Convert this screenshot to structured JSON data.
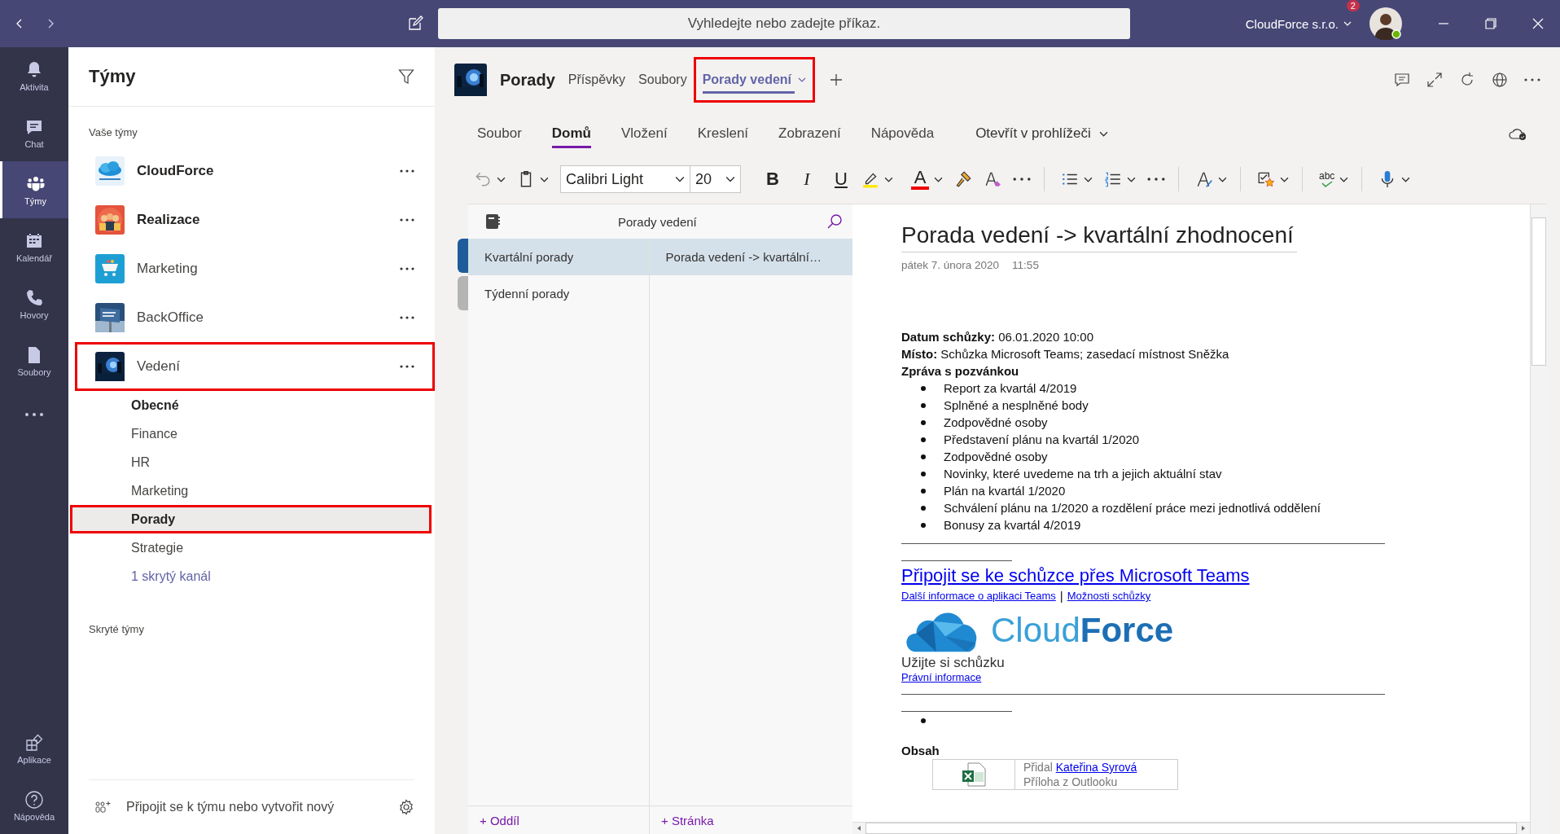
{
  "top_bar": {
    "search": {
      "placeholder": "Vyhledejte nebo zadejte příkaz."
    },
    "organization": "CloudForce s.r.o.",
    "notification_count": "2"
  },
  "rail": {
    "items": [
      {
        "label": "Aktivita",
        "selected": false
      },
      {
        "label": "Chat",
        "selected": false
      },
      {
        "label": "Týmy",
        "selected": true
      },
      {
        "label": "Kalendář",
        "selected": false
      },
      {
        "label": "Hovory",
        "selected": false
      },
      {
        "label": "Soubory",
        "selected": false
      }
    ],
    "bottom_items": [
      {
        "label": "Aplikace"
      },
      {
        "label": "Nápověda"
      }
    ]
  },
  "sidebar": {
    "title": "Týmy",
    "section_label": "Vaše týmy",
    "teams": [
      {
        "name": "CloudForce",
        "unread": true,
        "highlighted": false
      },
      {
        "name": "Realizace",
        "unread": true,
        "highlighted": false
      },
      {
        "name": "Marketing",
        "unread": false,
        "highlighted": false
      },
      {
        "name": "BackOffice",
        "unread": false,
        "highlighted": false
      },
      {
        "name": "Vedení",
        "unread": false,
        "highlighted": true,
        "children": [
          {
            "name": "Obecné",
            "unread": true,
            "selected": false,
            "highlighted": false
          },
          {
            "name": "Finance",
            "unread": false,
            "selected": false,
            "highlighted": false
          },
          {
            "name": "HR",
            "unread": false,
            "selected": false,
            "highlighted": false
          },
          {
            "name": "Marketing",
            "unread": false,
            "selected": false,
            "highlighted": false
          },
          {
            "name": "Porady",
            "unread": false,
            "selected": true,
            "highlighted": true
          },
          {
            "name": "Strategie",
            "unread": false,
            "selected": false,
            "highlighted": false
          }
        ],
        "hidden_channels_link": "1 skrytý kanál"
      }
    ],
    "hidden_teams_label": "Skryté týmy",
    "join_label": "Připojit se k týmu nebo vytvořit nový"
  },
  "channel_header": {
    "title": "Porady",
    "tabs": [
      {
        "label": "Příspěvky",
        "selected": false,
        "highlighted": false,
        "dropdown": false
      },
      {
        "label": "Soubory",
        "selected": false,
        "highlighted": false,
        "dropdown": false
      },
      {
        "label": "Porady vedení",
        "selected": true,
        "highlighted": true,
        "dropdown": true
      }
    ]
  },
  "ribbon": {
    "tabs": [
      {
        "label": "Soubor",
        "selected": false
      },
      {
        "label": "Domů",
        "selected": true
      },
      {
        "label": "Vložení",
        "selected": false
      },
      {
        "label": "Kreslení",
        "selected": false
      },
      {
        "label": "Zobrazení",
        "selected": false
      },
      {
        "label": "Nápověda",
        "selected": false
      }
    ],
    "open_in_browser": "Otevřít v prohlížeči",
    "toolbar": {
      "font": "Calibri Light",
      "size": "20",
      "bold": "B",
      "italic": "I",
      "underline": "U",
      "font_color": "A",
      "spelling": "abc"
    }
  },
  "notebook": {
    "name": "Porady vedení",
    "sections": [
      {
        "name": "Kvartální porady",
        "selected": true,
        "color": "#1e5b9a"
      },
      {
        "name": "Týdenní porady",
        "selected": false,
        "color": "#b4b4b4"
      }
    ],
    "pages": [
      {
        "title": "Porada vedení -> kvartální…",
        "selected": true
      }
    ],
    "add_section": "+ Oddíl",
    "add_page": "+ Stránka"
  },
  "page": {
    "title": "Porada vedení -> kvartální zhodnocení",
    "date": "pátek 7. února 2020",
    "time": "11:55",
    "fields": [
      "**Datum schůzky:** 06.01.2020 10:00",
      "**Místo:** Schůzka Microsoft Teams; zasedací místnost Sněžka"
    ],
    "invite_heading": "Zpráva s pozvánkou",
    "agenda": [
      "Report za kvartál 4/2019",
      "Splněné a nesplněné body",
      "Zodpovědné osoby",
      "Představení plánu na kvartál 1/2020",
      "Zodpovědné osoby",
      "Novinky, které uvedeme na trh a jejich aktuální stav",
      "Plán na kvartál 1/2020",
      "Schválení plánu na 1/2020 a rozdělení práce mezi jednotlivá oddělení",
      "Bonusy za kvartál 4/2019"
    ],
    "join_link": "Připojit se ke schůzce přes Microsoft Teams",
    "info_links": [
      "Další informace o aplikaci Teams",
      "Možnosti schůzky"
    ],
    "link_separator": "|",
    "logo_text": "Cloud**Force**",
    "enjoy": "Užijte si schůzku",
    "legal_link": "Právní informace",
    "contents_heading": "Obsah",
    "attachment": {
      "added_by": "Přidal",
      "author": "Kateřina Syrová",
      "source": "Příloha z Outlooku"
    }
  }
}
